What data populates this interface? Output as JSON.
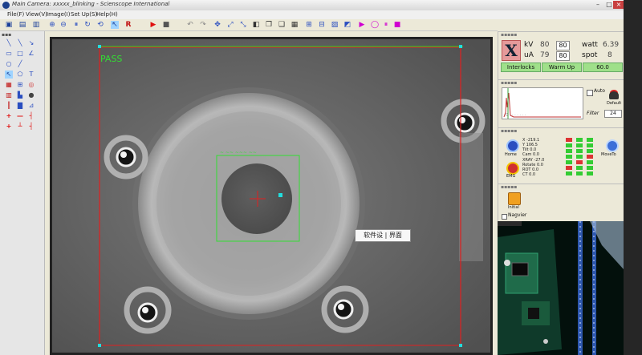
{
  "window": {
    "title": "Main Camera: xxxxx_blinking - Scienscope International"
  },
  "menu": [
    "File(F)",
    "View(V)",
    "Image(I)",
    "Set Up(S)",
    "Help(H)"
  ],
  "viewer": {
    "status": "PASS"
  },
  "xray": {
    "logo": "X",
    "kv_label": "kV",
    "kv_actual": "80",
    "kv_set": "80",
    "ua_label": "uA",
    "ua_actual": "79",
    "ua_set": "80",
    "watt_label": "watt",
    "watt_value": "6.39",
    "spot_label": "spot",
    "spot_value": "8",
    "interlocks_label": "Interlocks",
    "warmup_label": "Warm Up",
    "warmup_value": "60.0"
  },
  "controls": {
    "auto_label": "Auto",
    "default_label": "Default",
    "filter_label": "Filter",
    "filter_value": "24"
  },
  "motion": {
    "home_label": "Home",
    "move_label": "MoveTo",
    "emg_label": "EMG",
    "rows": [
      {
        "axis": "X",
        "value": "-219.1"
      },
      {
        "axis": "Y",
        "value": "106.5"
      },
      {
        "axis": "Tilt",
        "value": "0.0"
      },
      {
        "axis": "Cam",
        "value": "0.0"
      },
      {
        "axis": "XRAY",
        "value": "-27.0"
      },
      {
        "axis": "Rotate",
        "value": "0.0"
      },
      {
        "axis": "ROT",
        "value": "0.0"
      },
      {
        "axis": "CT",
        "value": "0.0"
      }
    ]
  },
  "navigator": {
    "initial_label": "Initial",
    "navigator_label": "Nagvier"
  },
  "tooltip": {
    "text": "软件设 | 界面"
  },
  "colors": {
    "accent_green": "#33cc33",
    "overlay_red": "#e02020",
    "overlay_green": "#33dd33",
    "cyan_marker": "#22dddd"
  }
}
